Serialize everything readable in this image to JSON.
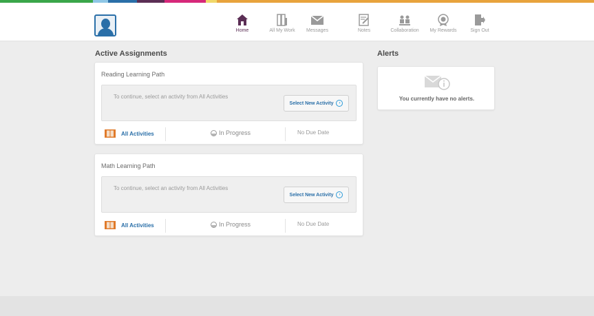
{
  "colors": {
    "stripe": [
      "#3aa64a",
      "#8fc7e6",
      "#2a6fa8",
      "#5b2e55",
      "#d6287a",
      "#e8a33c",
      "#e8a33c"
    ],
    "nav_active": "#5b2e55",
    "link": "#2a6fa8",
    "background": "#ededed"
  },
  "nav": {
    "items": [
      {
        "label": "Home",
        "icon": "home-icon",
        "active": true
      },
      {
        "label": "All My Work",
        "icon": "work-icon",
        "active": false
      },
      {
        "label": "Messages",
        "icon": "messages-icon",
        "active": false
      },
      {
        "label": "Notes",
        "icon": "notes-icon",
        "active": false
      },
      {
        "label": "Collaboration",
        "icon": "collaboration-icon",
        "active": false
      },
      {
        "label": "My Rewards",
        "icon": "rewards-icon",
        "active": false
      },
      {
        "label": "Sign Out",
        "icon": "sign-out-icon",
        "active": false
      }
    ]
  },
  "assignments": {
    "title": "Active Assignments",
    "cards": [
      {
        "title": "Reading Learning Path",
        "instruction": "To continue, select an activity from All Activities",
        "button": "Select New Activity",
        "link": "All Activities",
        "status": "In Progress",
        "due": "No Due Date"
      },
      {
        "title": "Math Learning Path",
        "instruction": "To continue, select an activity from All Activities",
        "button": "Select New Activity",
        "link": "All Activities",
        "status": "In Progress",
        "due": "No Due Date"
      }
    ]
  },
  "alerts": {
    "title": "Alerts",
    "empty_message": "You currently have no alerts."
  }
}
